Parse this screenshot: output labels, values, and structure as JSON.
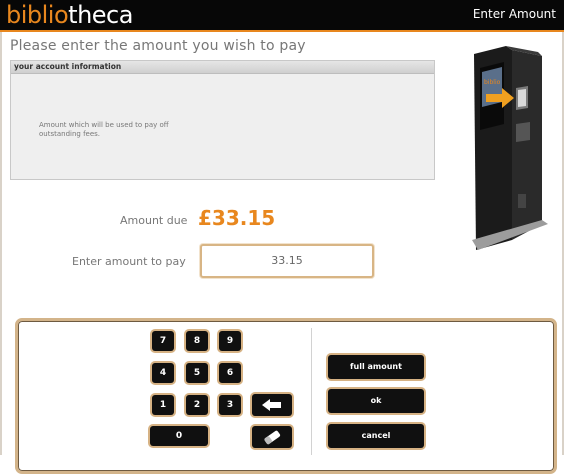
{
  "app": {
    "logo_part1": "biblio",
    "logo_part2": "theca",
    "screen_title": "Enter Amount"
  },
  "page": {
    "heading": "Please enter the amount you wish to pay"
  },
  "account_panel": {
    "header": "your account information",
    "body": "Amount which will be used to pay off outstanding fees."
  },
  "payment": {
    "amount_due_label": "Amount due",
    "amount_due_value": "£33.15",
    "enter_label": "Enter amount to pay",
    "enter_value": "33.15"
  },
  "keypad": {
    "k7": "7",
    "k8": "8",
    "k9": "9",
    "k4": "4",
    "k5": "5",
    "k6": "6",
    "k1": "1",
    "k2": "2",
    "k3": "3",
    "k0": "0",
    "backspace_icon": "left-arrow-icon",
    "clear_icon": "eraser-icon"
  },
  "actions": {
    "full_amount": "full amount",
    "ok": "ok",
    "cancel": "cancel"
  },
  "colors": {
    "accent": "#e8871e",
    "key_bg": "#101010",
    "key_border": "#d6b284"
  }
}
